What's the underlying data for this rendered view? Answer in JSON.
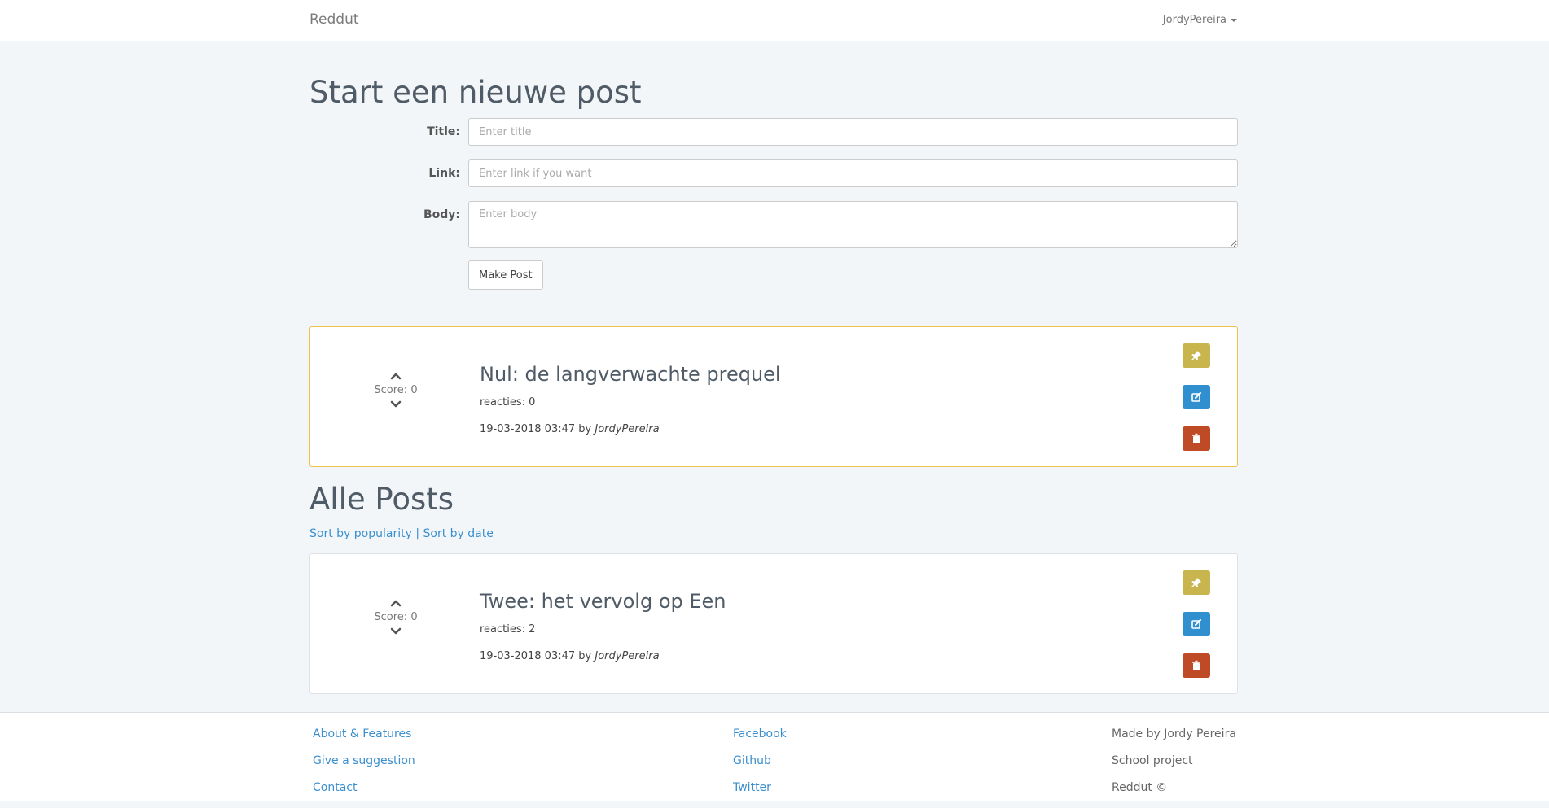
{
  "navbar": {
    "brand": "Reddut",
    "user": "JordyPereira"
  },
  "new_post": {
    "heading": "Start een nieuwe post",
    "title_label": "Title:",
    "title_placeholder": "Enter title",
    "link_label": "Link:",
    "link_placeholder": "Enter link if you want",
    "body_label": "Body:",
    "body_placeholder": "Enter body",
    "submit_label": "Make Post"
  },
  "pinned_post": {
    "title": "Nul: de langverwachte prequel",
    "score_text": "Score: 0",
    "replies_text": "reacties: 0",
    "date": "19-03-2018 03:47",
    "by": "by",
    "author": "JordyPereira"
  },
  "all_posts": {
    "heading": "Alle Posts",
    "sort_popularity": "Sort by popularity",
    "separator": "|",
    "sort_date": "Sort by date",
    "posts": [
      {
        "title": "Twee: het vervolg op Een",
        "score_text": "Score: 0",
        "replies_text": "reacties: 2",
        "date": "19-03-2018 03:47",
        "by": "by",
        "author": "JordyPereira"
      }
    ]
  },
  "footer": {
    "col1": [
      "About & Features",
      "Give a suggestion",
      "Contact"
    ],
    "col2": [
      "Facebook",
      "Github",
      "Twitter"
    ],
    "col3": [
      "Made by Jordy Pereira",
      "School project",
      "Reddut ©"
    ]
  },
  "icons": {
    "pin": "pushpin-icon",
    "edit": "edit-icon",
    "delete": "trash-icon",
    "up": "chevron-up-icon",
    "down": "chevron-down-icon"
  },
  "colors": {
    "pin_button": "#c9b54d",
    "edit_button": "#2f8fcf",
    "delete_button": "#bf4a26",
    "pinned_border": "#f0c14b",
    "link": "#3a8fcf"
  }
}
